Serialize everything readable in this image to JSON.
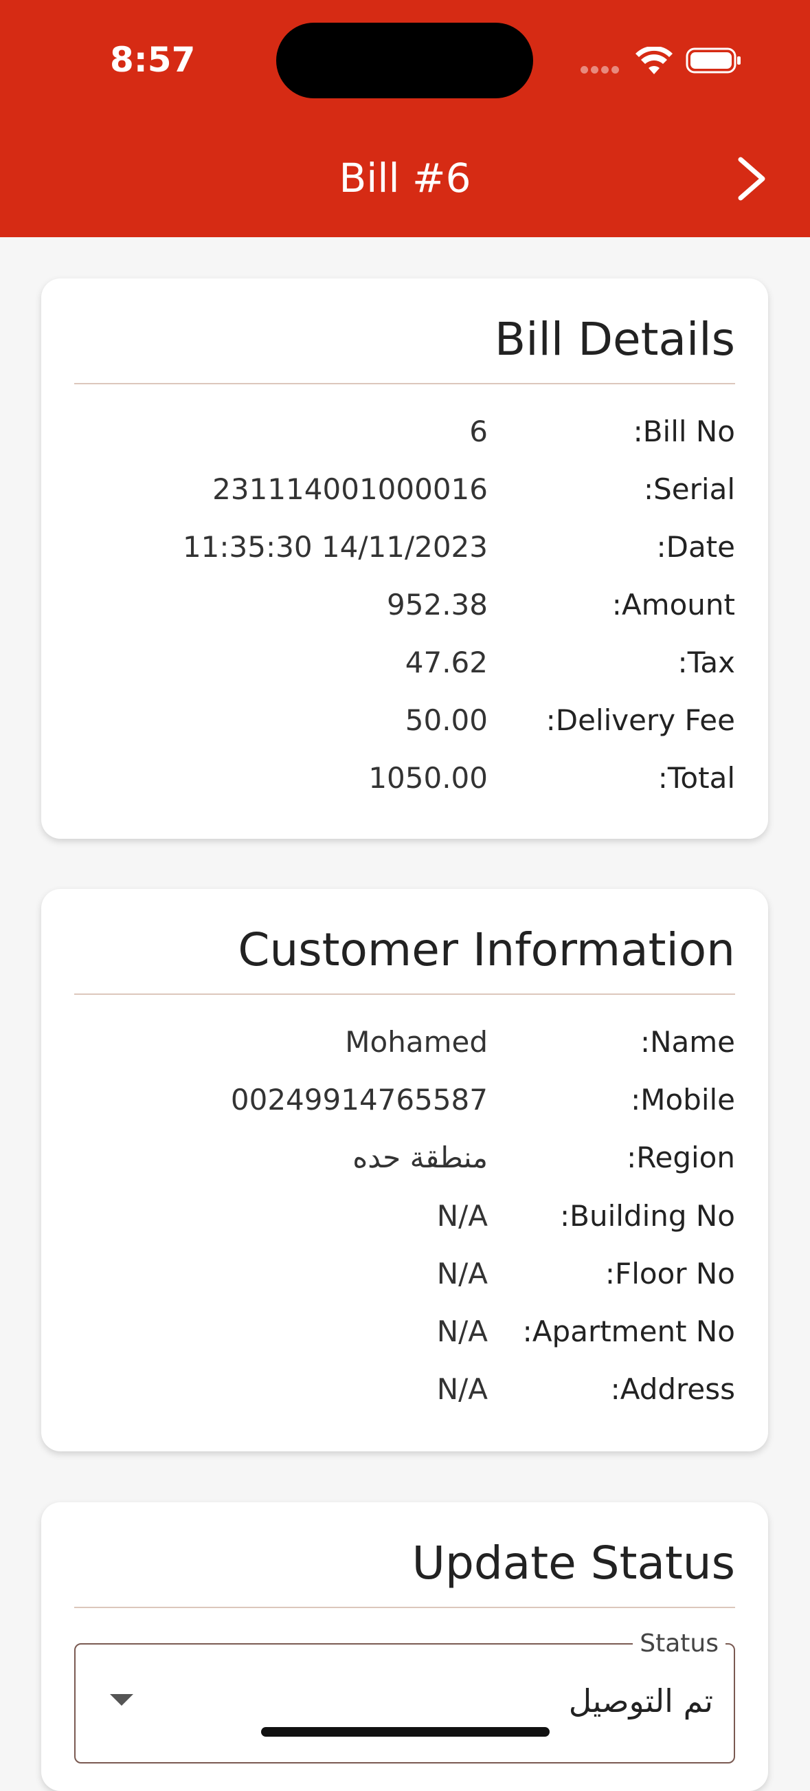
{
  "status_bar": {
    "time": "8:57"
  },
  "header": {
    "title": "Bill #6",
    "forward_icon": "chevron-right-icon"
  },
  "bill_details": {
    "title": "Bill Details",
    "rows": [
      {
        "label": ":Bill No",
        "value": "6"
      },
      {
        "label": ":Serial",
        "value": "231114001000016"
      },
      {
        "label": ":Date",
        "value": "11:35:30 14/11/2023"
      },
      {
        "label": ":Amount",
        "value": "952.38"
      },
      {
        "label": ":Tax",
        "value": "47.62"
      },
      {
        "label": ":Delivery Fee",
        "value": "50.00"
      },
      {
        "label": ":Total",
        "value": "1050.00"
      }
    ]
  },
  "customer_info": {
    "title": "Customer Information",
    "rows": [
      {
        "label": ":Name",
        "value": "Mohamed"
      },
      {
        "label": ":Mobile",
        "value": "00249914765587"
      },
      {
        "label": ":Region",
        "value": "منطقة حده"
      },
      {
        "label": ":Building No",
        "value": "N/A"
      },
      {
        "label": ":Floor No",
        "value": "N/A"
      },
      {
        "label": ":Apartment No",
        "value": "N/A"
      },
      {
        "label": ":Address",
        "value": "N/A"
      }
    ]
  },
  "update_status": {
    "title": "Update Status",
    "field_label": "Status",
    "selected": "تم التوصيل"
  },
  "colors": {
    "accent": "#d62b14",
    "divider": "#dcc7bc",
    "background": "#f6f6f6"
  }
}
